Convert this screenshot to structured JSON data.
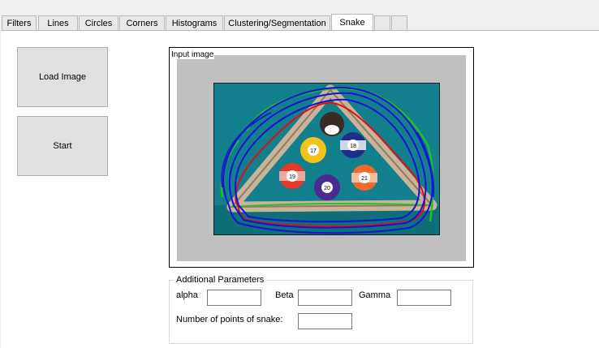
{
  "tabs": [
    {
      "label": "Filters"
    },
    {
      "label": "Lines"
    },
    {
      "label": "Circles"
    },
    {
      "label": "Corners"
    },
    {
      "label": "Histograms"
    },
    {
      "label": "Clustering/Segmentation"
    },
    {
      "label": "Snake",
      "active": true
    },
    {
      "label": ""
    },
    {
      "label": ""
    }
  ],
  "buttons": {
    "load_image": "Load Image",
    "start": "Start"
  },
  "image_panel": {
    "label": "Input image",
    "content": "billiard balls in triangle rack with snake contours"
  },
  "balls": [
    "17",
    "18",
    "19",
    "20",
    "21"
  ],
  "contour_colors": {
    "snake": "#1010d0",
    "initial": "#e01010",
    "edges": "#20c020"
  },
  "params": {
    "title": "Additional Parameters",
    "alpha_label": "alpha",
    "alpha_value": "",
    "beta_label": "Beta",
    "beta_value": "",
    "gamma_label": "Gamma",
    "gamma_value": "",
    "points_label": "Number of points of snake:",
    "points_value": ""
  }
}
